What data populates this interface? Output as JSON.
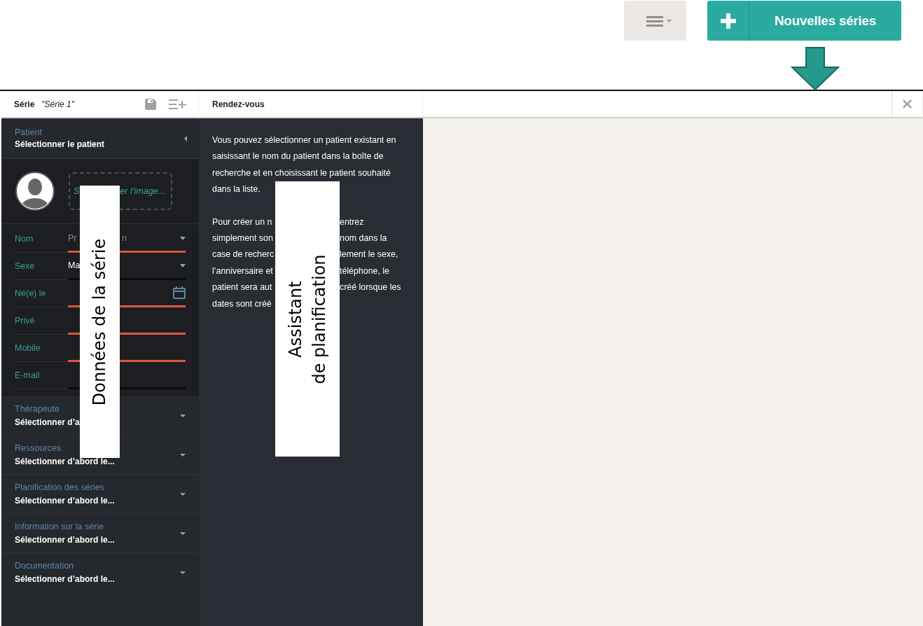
{
  "toolbar": {
    "new_button": {
      "label": "Nouvelles séries"
    }
  },
  "series_panel": {
    "title": "Série",
    "name": "\"Série 1\"",
    "patient": {
      "title": "Patient",
      "value": "Sélectionner le patient",
      "expanded": true
    },
    "image_drop": {
      "parts": [
        "S",
        "er l’image..."
      ]
    },
    "fields": [
      {
        "label": "Nom",
        "kind": "select",
        "parts": [
          "Pr",
          "n"
        ],
        "required": true
      },
      {
        "label": "Sexe",
        "kind": "select",
        "parts": [
          "Ma"
        ],
        "required": false
      },
      {
        "label": "Né(e) le",
        "kind": "date",
        "required": true
      },
      {
        "label": "Privé",
        "kind": "text",
        "required": true
      },
      {
        "label": "Mobile",
        "kind": "text",
        "required": true
      },
      {
        "label": "E-mail",
        "kind": "text",
        "required": false
      }
    ],
    "sections": [
      {
        "title": "Thérapeute",
        "value": "Sélectionner d’a",
        "expanded": false
      },
      {
        "title": "Ressources",
        "value": "Sélectionner d’abord le...",
        "expanded": false
      },
      {
        "title": "Planification des séries",
        "value": "Sélectionner d’abord le...",
        "expanded": false
      },
      {
        "title": "Information sur la série",
        "value": "Sélectionner d’abord le...",
        "expanded": false
      },
      {
        "title": "Documentation",
        "value": "Sélectionner d’abord le...",
        "expanded": false
      }
    ]
  },
  "appointments_panel": {
    "title": "Rendez-vous",
    "paragraph": "Vous pouvez sélectionner un patient existant en saisissant le nom du patient dans la boîte de recherche et en choisissant le patient souhaité dans la liste.",
    "split_lines": [
      [
        "Pour créer un n",
        "entrez"
      ],
      [
        "simplement son",
        "nom dans la"
      ],
      [
        "case de recherc",
        "lement le sexe,"
      ],
      [
        "l’anniversaire et",
        "téléphone, le"
      ],
      [
        "patient sera aut",
        "créé lorsque les"
      ],
      [
        "dates sont créé"
      ]
    ]
  },
  "annotations": [
    {
      "lines": [
        "Données de la série"
      ]
    },
    {
      "lines": [
        "Assistant",
        "de planification"
      ]
    }
  ]
}
